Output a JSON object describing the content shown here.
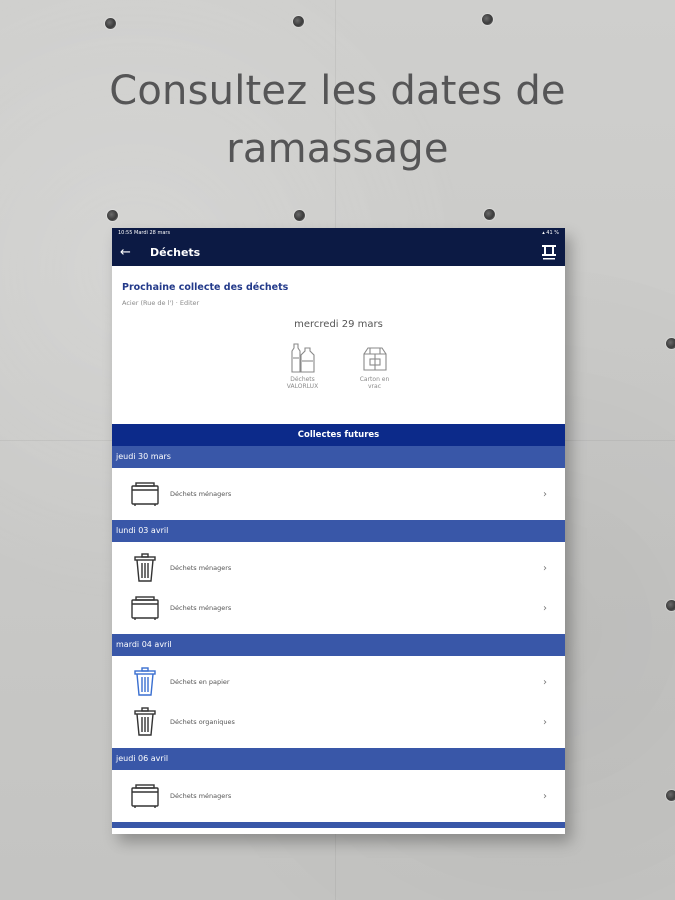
{
  "headline": {
    "line1": "Consultez les dates de",
    "line2": "ramassage"
  },
  "status": {
    "time_date": "10:55  Mardi 28 mars",
    "battery": "▴ 41 %"
  },
  "appbar": {
    "back_icon": "arrow-left-icon",
    "title": "Déchets",
    "logo_icon": "app-logo-icon"
  },
  "next_collection": {
    "title": "Prochaine collecte des déchets",
    "address": "Acier (Rue de l') · Editer",
    "date": "mercredi 29 mars",
    "items": [
      {
        "label": "Déchets VALORLUX",
        "icon": "bottles-icon"
      },
      {
        "label": "Carton en vrac",
        "icon": "cardboard-box-icon"
      }
    ]
  },
  "future": {
    "header": "Collectes futures",
    "days": [
      {
        "date": "jeudi 30 mars",
        "items": [
          {
            "label": "Déchets ménagers",
            "icon": "bin-icon"
          }
        ]
      },
      {
        "date": "lundi 03 avril",
        "items": [
          {
            "label": "Déchets ménagers",
            "icon": "trash-can-icon"
          },
          {
            "label": "Déchets ménagers",
            "icon": "bin-icon"
          }
        ]
      },
      {
        "date": "mardi 04 avril",
        "items": [
          {
            "label": "Déchets en papier",
            "icon": "paper-bin-icon"
          },
          {
            "label": "Déchets organiques",
            "icon": "trash-can-icon"
          }
        ]
      },
      {
        "date": "jeudi 06 avril",
        "items": [
          {
            "label": "Déchets ménagers",
            "icon": "bin-icon"
          }
        ]
      }
    ]
  },
  "colors": {
    "navy": "#0c1a44",
    "blue_header": "#0c2a8a",
    "day_bar": "#3957a8",
    "accent_text": "#233a8a",
    "paper_icon": "#3a6fd0"
  }
}
